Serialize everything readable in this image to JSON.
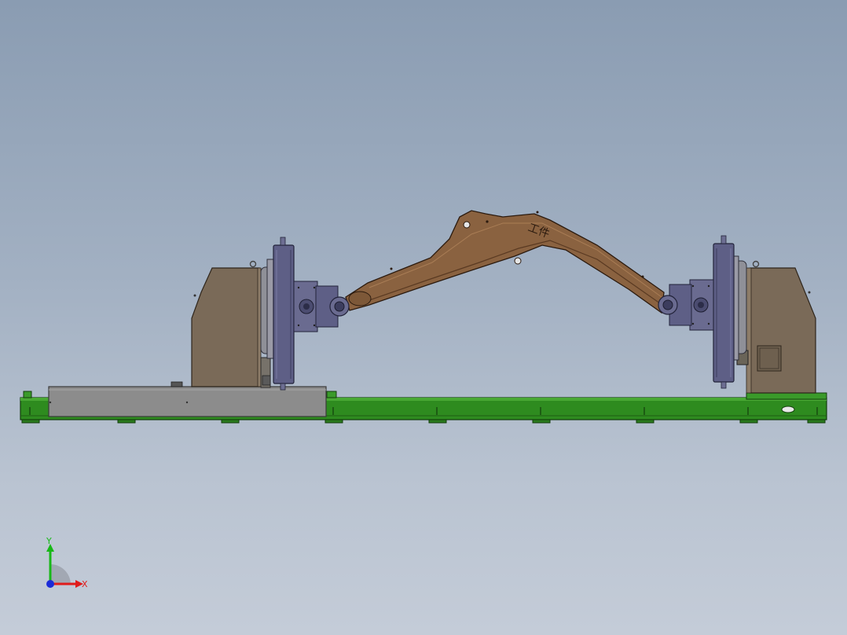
{
  "viewport": {
    "background_top": "#8a9cb2",
    "background_bottom": "#c4ccd8"
  },
  "model": {
    "arm_label": "工件",
    "colors": {
      "base_frame": "#2e8b1f",
      "headstock_body": "#7a6a58",
      "faceplate": "#5e5f86",
      "workpiece": "#8a6240",
      "cover_box": "#8c8c8c"
    }
  },
  "triad": {
    "x_label": "X",
    "y_label": "Y",
    "colors": {
      "x": "#e01b1b",
      "y": "#18b818",
      "z": "#1b2bd8"
    }
  }
}
